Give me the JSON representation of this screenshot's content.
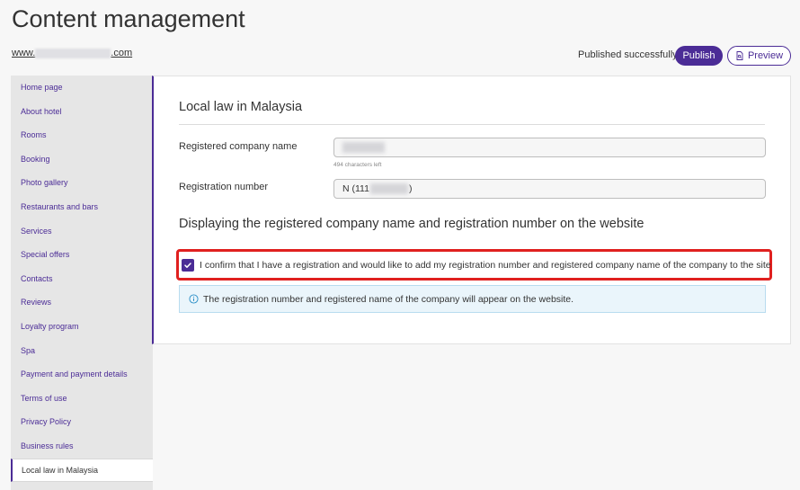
{
  "header": {
    "title": "Content management",
    "site_link_prefix": "www.",
    "site_link_suffix": ".com",
    "publish_status": "Published successfully",
    "publish_label": "Publish",
    "preview_label": "Preview"
  },
  "sidebar": {
    "items": [
      {
        "label": "Home page"
      },
      {
        "label": "About hotel"
      },
      {
        "label": "Rooms"
      },
      {
        "label": "Booking"
      },
      {
        "label": "Photo gallery"
      },
      {
        "label": "Restaurants and bars"
      },
      {
        "label": "Services"
      },
      {
        "label": "Special offers"
      },
      {
        "label": "Contacts"
      },
      {
        "label": "Reviews"
      },
      {
        "label": "Loyalty program"
      },
      {
        "label": "Spa"
      },
      {
        "label": "Payment and payment details"
      },
      {
        "label": "Terms of use"
      },
      {
        "label": "Privacy Policy"
      },
      {
        "label": "Business rules"
      },
      {
        "label": "Local law in Malaysia",
        "active": true
      }
    ]
  },
  "main": {
    "section_title": "Local law in Malaysia",
    "company_name_label": "Registered company name",
    "company_name_hint": "494 characters left",
    "registration_label": "Registration number",
    "registration_prefix": "N (111",
    "registration_suffix": ")",
    "display_title": "Displaying the registered company name and registration number on the website",
    "confirm_checked": true,
    "confirm_text": "I confirm that I have a registration and would like to add my registration number and registered company name of the company to the site",
    "info_text": "The registration number and registered name of the company will appear on the website."
  },
  "colors": {
    "accent": "#4b2c96",
    "highlight_border": "#e0201f",
    "info_background": "#eaf5fb",
    "info_icon": "#2a8fc7"
  }
}
